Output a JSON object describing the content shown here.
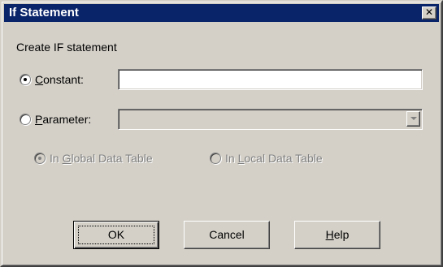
{
  "window": {
    "title": "If Statement",
    "close_glyph": "✕"
  },
  "form": {
    "heading": "Create IF statement",
    "constant": {
      "label_prefix": "",
      "label_hotkey": "C",
      "label_rest": "onstant:",
      "selected": true,
      "value": ""
    },
    "parameter": {
      "label_prefix": "",
      "label_hotkey": "P",
      "label_rest": "arameter:",
      "selected": false,
      "value": "",
      "enabled": false
    },
    "scope": {
      "global": {
        "label_prefix": "In ",
        "label_hotkey": "G",
        "label_rest": "lobal Data Table",
        "selected": true,
        "enabled": false
      },
      "local": {
        "label_prefix": "In ",
        "label_hotkey": "L",
        "label_rest": "ocal Data Table",
        "selected": false,
        "enabled": false
      }
    }
  },
  "buttons": {
    "ok": {
      "label_prefix": "",
      "label_hotkey": "",
      "label_rest": "OK"
    },
    "cancel": {
      "label_prefix": "",
      "label_hotkey": "",
      "label_rest": "Cancel"
    },
    "help": {
      "label_prefix": "",
      "label_hotkey": "H",
      "label_rest": "elp"
    }
  },
  "icons": {
    "close": "close-icon",
    "dropdown": "chevron-down-icon"
  },
  "colors": {
    "face": "#d4d0c8",
    "titlebar": "#0a246a",
    "title_text": "#ffffff",
    "disabled_text": "#808080"
  }
}
